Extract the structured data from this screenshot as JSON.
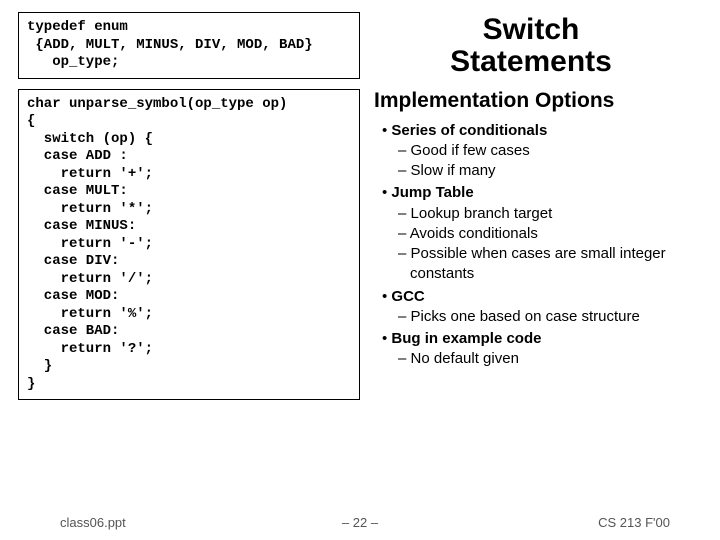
{
  "title_line1": "Switch",
  "title_line2": "Statements",
  "typedef_code": "typedef enum\n {ADD, MULT, MINUS, DIV, MOD, BAD}\n   op_type;",
  "function_code": "char unparse_symbol(op_type op)\n{\n  switch (op) {\n  case ADD :\n    return '+';\n  case MULT:\n    return '*';\n  case MINUS:\n    return '-';\n  case DIV:\n    return '/';\n  case MOD:\n    return '%';\n  case BAD:\n    return '?';\n  }\n}",
  "options_heading": "Implementation Options",
  "bullets": {
    "b0": "Series of conditionals",
    "b0a": "Good if few cases",
    "b0b": "Slow if many",
    "b1": "Jump Table",
    "b1a": "Lookup branch target",
    "b1b": "Avoids conditionals",
    "b1c": "Possible when cases are small integer constants",
    "b2": "GCC",
    "b2a": "Picks one based on case structure",
    "b3": "Bug in example code",
    "b3a": "No default given"
  },
  "footer": {
    "left": "class06.ppt",
    "center": "– 22 –",
    "right": "CS 213 F'00"
  }
}
